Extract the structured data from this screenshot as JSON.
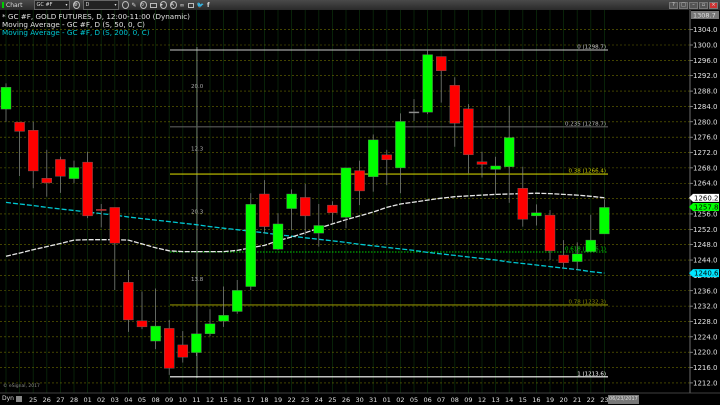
{
  "toolbar": {
    "chart_label": "Chart",
    "symbol": "GC #F",
    "interval": "D",
    "icons": [
      "gear-icon",
      "clock-icon",
      "pencil-icon",
      "refresh-icon",
      "annotation-icon",
      "play-icon",
      "alert-icon",
      "link-icon",
      "comment-icon",
      "twitter-icon",
      "facebook-icon"
    ],
    "window_buttons": [
      "help",
      "restore",
      "minimize",
      "maximize",
      "close"
    ]
  },
  "legend": {
    "line1": "* GC #F, GOLD FUTURES, D, 12:00-11:00 (Dynamic)",
    "line2": "Moving Average - GC #F, D (S, 50, 0, C)",
    "line3": "Moving Average - GC #F, D (S, 200, 0, C)"
  },
  "colors": {
    "up": "#00ff00",
    "down": "#ff0000",
    "ma50": "#e6e6e6",
    "ma200": "#00c8d2",
    "grid": "#6b6b00",
    "background": "#000000"
  },
  "footer": {
    "copyright": "© eSignal, 2017",
    "dyn_label": "Dyn",
    "cursor_date": "06/23/2017"
  },
  "chart_data": {
    "type": "candlestick",
    "symbol": "GC #F",
    "y_ticks": [
      1212,
      1216,
      1220,
      1224,
      1228,
      1232,
      1236,
      1240,
      1244,
      1248,
      1252,
      1256,
      1260,
      1264,
      1268,
      1272,
      1276,
      1280,
      1284,
      1288,
      1292,
      1296,
      1300,
      1304
    ],
    "ylim": [
      1208.5,
      1308.7
    ],
    "top_label": "1308.7",
    "x_labels": [
      "25",
      "26",
      "27",
      "28",
      "01",
      "02",
      "03",
      "04",
      "05",
      "08",
      "09",
      "10",
      "11",
      "12",
      "15",
      "16",
      "17",
      "18",
      "19",
      "22",
      "23",
      "24",
      "25",
      "26",
      "30",
      "31",
      "01",
      "02",
      "05",
      "06",
      "07",
      "08",
      "09",
      "12",
      "13",
      "14",
      "15",
      "16",
      "19",
      "20",
      "21",
      "22",
      "23"
    ],
    "ohlc": [
      [
        1283.3,
        1290.0,
        1280.0,
        1289.0
      ],
      [
        1279.9,
        1279.9,
        1265.9,
        1277.5
      ],
      [
        1277.8,
        1280.0,
        1262.7,
        1267.2
      ],
      [
        1265.3,
        1272.7,
        1260.5,
        1264.1
      ],
      [
        1270.2,
        1270.9,
        1261.5,
        1265.8
      ],
      [
        1265.2,
        1269.9,
        1264.0,
        1268.1
      ],
      [
        1269.5,
        1272.2,
        1254.9,
        1255.5
      ],
      [
        1257.2,
        1258.6,
        1252.5,
        1257.0
      ],
      [
        1257.7,
        1257.7,
        1236.2,
        1248.4
      ],
      [
        1238.2,
        1241.4,
        1225.3,
        1228.4
      ],
      [
        1228.2,
        1235.8,
        1226.0,
        1226.6
      ],
      [
        1222.9,
        1236.6,
        1220.8,
        1226.8
      ],
      [
        1226.2,
        1228.4,
        1214.1,
        1215.8
      ],
      [
        1221.9,
        1225.5,
        1217.3,
        1218.7
      ],
      [
        1219.9,
        1224.8,
        1219.0,
        1224.8
      ],
      [
        1224.8,
        1231.2,
        1224.2,
        1227.4
      ],
      [
        1228.1,
        1237.1,
        1226.6,
        1229.6
      ],
      [
        1230.6,
        1238.8,
        1230.0,
        1236.1
      ],
      [
        1237.1,
        1261.4,
        1236.2,
        1258.5
      ],
      [
        1261.2,
        1264.8,
        1251.0,
        1252.7
      ],
      [
        1246.8,
        1256.2,
        1246.6,
        1253.4
      ],
      [
        1257.4,
        1262.4,
        1251.8,
        1261.2
      ],
      [
        1260.3,
        1263.8,
        1250.5,
        1255.5
      ],
      [
        1251.0,
        1258.6,
        1247.5,
        1253.0
      ],
      [
        1258.3,
        1259.3,
        1253.7,
        1256.3
      ],
      [
        1255.1,
        1268.0,
        1252.3,
        1268.0
      ],
      [
        1267.3,
        1269.9,
        1258.3,
        1262.0
      ],
      [
        1265.7,
        1276.7,
        1261.8,
        1275.3
      ],
      [
        1271.4,
        1272.7,
        1263.5,
        1270.1
      ],
      [
        1268.0,
        1282.2,
        1261.4,
        1280.1
      ],
      [
        1282.6,
        1285.9,
        1280.2,
        1282.6
      ],
      [
        1282.5,
        1298.7,
        1282.0,
        1297.5
      ],
      [
        1297.0,
        1297.0,
        1285.0,
        1293.3
      ],
      [
        1289.5,
        1291.6,
        1273.5,
        1279.6
      ],
      [
        1283.4,
        1284.6,
        1266.6,
        1271.4
      ],
      [
        1269.6,
        1272.2,
        1265.5,
        1268.9
      ],
      [
        1267.6,
        1270.9,
        1260.9,
        1268.5
      ],
      [
        1268.3,
        1284.2,
        1258.9,
        1275.9
      ],
      [
        1262.7,
        1268.3,
        1252.7,
        1254.6
      ],
      [
        1255.5,
        1258.5,
        1253.0,
        1256.3
      ],
      [
        1255.7,
        1257.0,
        1244.0,
        1246.4
      ],
      [
        1245.3,
        1249.2,
        1242.1,
        1243.3
      ],
      [
        1243.6,
        1248.6,
        1241.4,
        1245.6
      ],
      [
        1246.2,
        1255.8,
        1246.2,
        1249.2
      ],
      [
        1250.8,
        1259.8,
        1250.8,
        1257.7
      ]
    ],
    "ma50": [
      1245.0,
      1245.8,
      1246.7,
      1247.5,
      1248.3,
      1249.2,
      1249.3,
      1249.3,
      1249.3,
      1249.2,
      1248.2,
      1247.2,
      1246.4,
      1246.2,
      1246.2,
      1246.2,
      1246.2,
      1246.5,
      1247.2,
      1247.8,
      1249.0,
      1250.0,
      1251.1,
      1252.3,
      1253.4,
      1254.5,
      1255.5,
      1256.5,
      1257.7,
      1258.6,
      1259.1,
      1259.6,
      1260.1,
      1260.5,
      1260.7,
      1260.9,
      1261.1,
      1261.2,
      1261.3,
      1261.4,
      1261.3,
      1261.1,
      1260.9,
      1260.6,
      1260.2
    ],
    "ma200": [
      1259.0,
      1258.6,
      1258.2,
      1257.7,
      1257.3,
      1256.9,
      1256.5,
      1256.1,
      1255.7,
      1255.2,
      1254.8,
      1254.4,
      1254.0,
      1253.6,
      1253.2,
      1252.7,
      1252.3,
      1251.9,
      1251.5,
      1251.1,
      1250.6,
      1250.2,
      1249.8,
      1249.4,
      1249.0,
      1248.6,
      1248.1,
      1247.7,
      1247.3,
      1246.9,
      1246.5,
      1246.0,
      1245.6,
      1245.2,
      1244.8,
      1244.4,
      1244.0,
      1243.5,
      1243.1,
      1242.7,
      1242.3,
      1241.9,
      1241.5,
      1241.0,
      1240.6
    ],
    "price_markers": [
      {
        "label": "1260.2",
        "value": 1260.2,
        "color": "#ffffff",
        "text_color": "#000000"
      },
      {
        "label": "1257.8",
        "value": 1257.8,
        "color": "#00ff00",
        "text_color": "#000000"
      },
      {
        "label": "1240.6",
        "value": 1240.6,
        "color": "#00e5ff",
        "text_color": "#000000"
      }
    ],
    "fib_levels": [
      {
        "label": "0 (1298.7)",
        "value": 1298.7,
        "color": "#c8c8c8",
        "style": "solid"
      },
      {
        "label": "0.235 (1278.7)",
        "value": 1278.7,
        "color": "#5a5a5a",
        "style": "solid"
      },
      {
        "label": "0.38 (1266.4)",
        "value": 1266.4,
        "color": "#c8c800",
        "style": "solid"
      },
      {
        "label": "0.618 (1246.1)",
        "value": 1246.1,
        "color": "#00d000",
        "style": "dotted"
      },
      {
        "label": "0.78 (1232.3)",
        "value": 1232.3,
        "color": "#8a8a00",
        "style": "solid"
      },
      {
        "label": "1 (1213.6)",
        "value": 1213.6,
        "color": "#ffffff",
        "style": "solid"
      }
    ],
    "time_ratios": [
      {
        "label": "20.0",
        "value": 1289.3
      },
      {
        "label": "12.3",
        "value": 1273.0
      },
      {
        "label": "20.3",
        "value": 1256.6
      },
      {
        "label": "13.8",
        "value": 1239.1
      }
    ],
    "grid": true
  }
}
